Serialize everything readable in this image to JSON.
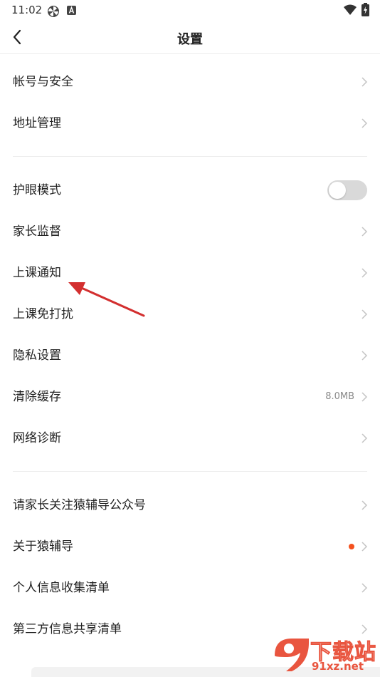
{
  "status_bar": {
    "time": "11:02"
  },
  "header": {
    "title": "设置"
  },
  "section1": [
    {
      "label": "帐号与安全"
    },
    {
      "label": "地址管理"
    }
  ],
  "section2": [
    {
      "label": "护眼模式",
      "toggle_on": false
    },
    {
      "label": "家长监督"
    },
    {
      "label": "上课通知"
    },
    {
      "label": "上课免打扰"
    },
    {
      "label": "隐私设置"
    },
    {
      "label": "清除缓存",
      "value": "8.0MB"
    },
    {
      "label": "网络诊断"
    }
  ],
  "section3": [
    {
      "label": "请家长关注猿辅导公众号"
    },
    {
      "label": "关于猿辅导",
      "has_badge": true
    },
    {
      "label": "个人信息收集清单"
    },
    {
      "label": "第三方信息共享清单"
    }
  ],
  "watermark": {
    "title": "下载站",
    "site": "91xz.net"
  },
  "colors": {
    "accent_red": "#f4511e",
    "annotation_arrow": "#d32f2f",
    "watermark": "#e9553f"
  }
}
